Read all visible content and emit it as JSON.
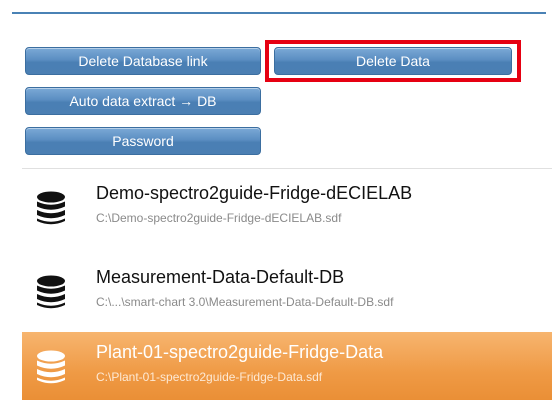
{
  "buttons": {
    "delete_database_link": "Delete Database link",
    "delete_data": "Delete Data",
    "auto_data_extract": "Auto data extract → DB",
    "password": "Password"
  },
  "database_list": {
    "items": [
      {
        "title": "Demo-spectro2guide-Fridge-dECIELAB",
        "path": "C:\\Demo-spectro2guide-Fridge-dECIELAB.sdf",
        "icon": "database-icon",
        "selected": false
      },
      {
        "title": "Measurement-Data-Default-DB",
        "path": "C:\\...\\smart-chart 3.0\\Measurement-Data-Default-DB.sdf",
        "icon": "database-icon",
        "selected": false
      },
      {
        "title": "Plant-01-spectro2guide-Fridge-Data",
        "path": "C:\\Plant-01-spectro2guide-Fridge-Data.sdf",
        "icon": "database-icon",
        "selected": true
      }
    ]
  },
  "colors": {
    "button_blue": "#5b8ec2",
    "highlight_red": "#e60012",
    "selected_orange": "#ef9a45",
    "rule_blue": "#4a82b5"
  }
}
